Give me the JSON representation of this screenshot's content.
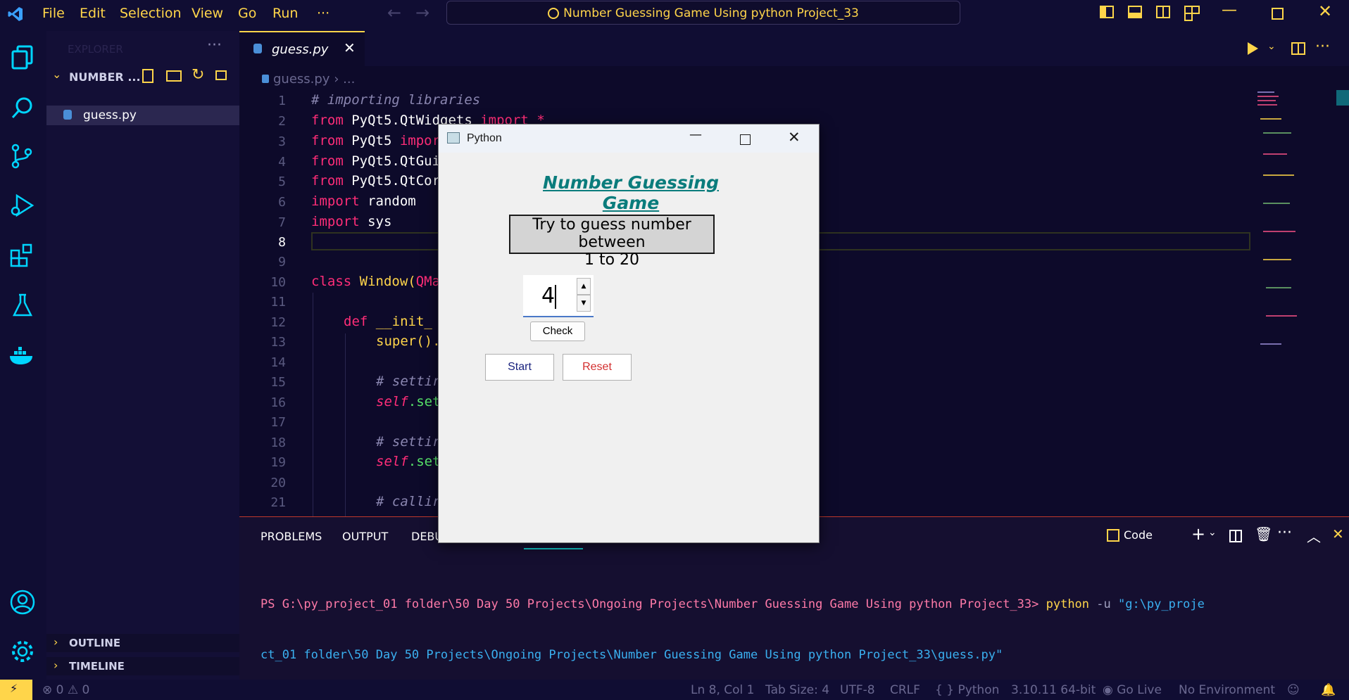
{
  "titlebar": {
    "menu": [
      "File",
      "Edit",
      "Selection",
      "View",
      "Go",
      "Run",
      "···"
    ],
    "search": "Number Guessing Game Using python Project_33"
  },
  "sidebar": {
    "header": "EXPLORER",
    "folder": "NUMBER ...",
    "file": "guess.py",
    "outline": "OUTLINE",
    "timeline": "TIMELINE"
  },
  "editor": {
    "tab": "guess.py",
    "breadcrumb_file": "guess.py",
    "breadcrumb_rest": "...",
    "line_numbers": [
      "1",
      "2",
      "3",
      "4",
      "5",
      "6",
      "7",
      "8",
      "9",
      "10",
      "11",
      "12",
      "13",
      "14",
      "15",
      "16",
      "17",
      "18",
      "19",
      "20",
      "21"
    ],
    "lines": {
      "l1_comment": "# importing libraries",
      "l2_from": "from",
      "l2_mod": " PyQt5.QtWidgets",
      "l2_import": " import",
      "l2_star": " *",
      "l3_from": "from",
      "l3_mod": " PyQt5",
      "l3_import": " impor",
      "l4_from": "from",
      "l4_mod": " PyQt5.QtGui",
      "l5_from": "from",
      "l5_mod": " PyQt5.QtCor",
      "l6_import": "import",
      "l6_mod": " random",
      "l7_import": "import",
      "l7_mod": " sys",
      "l10_class": "class",
      "l10_name": " Window(",
      "l10_base": "QMa",
      "l12_def": "def",
      "l12_name": " __init_",
      "l13_text": "super().",
      "l15_comment": "# settir",
      "l16_self": "self",
      "l16_rest": ".set",
      "l18_comment": "# settir",
      "l19_self": "self",
      "l19_rest": ".set",
      "l21_comment": "# callir"
    }
  },
  "panel": {
    "tabs": [
      "PROBLEMS",
      "OUTPUT",
      "DEBU"
    ],
    "terminal_label": "Code",
    "terminal_line1_prompt": "PS G:\\py_project_01 folder\\50 Day 50 Projects\\Ongoing Projects\\Number Guessing Game Using python Project_33>",
    "terminal_cmd": " python",
    "terminal_flag": " -u",
    "terminal_path1": " \"g:\\py_proje",
    "terminal_line2": "ct_01 folder\\50 Day 50 Projects\\Ongoing Projects\\Number Guessing Game Using python Project_33\\guess.py\""
  },
  "statusbar": {
    "problems": "0",
    "warnings": "0",
    "position": "Ln 8, Col 1",
    "tabsize": "Tab Size: 4",
    "encoding": "UTF-8",
    "eol": "CRLF",
    "language": "Python",
    "version": "3.10.11 64-bit",
    "golive": "Go Live",
    "env": "No Environment"
  },
  "dialog": {
    "title": "Python",
    "heading": "Number Guessing Game",
    "info_line1": "Try to guess number between",
    "info_line2": "1 to 20",
    "spin_value": "4",
    "check": "Check",
    "start": "Start",
    "reset": "Reset"
  },
  "colors": {
    "accent": "#ffd54a",
    "keyword": "#ff2d78",
    "heading": "#0a7c7c",
    "start_text": "#1a237e",
    "reset_text": "#d32f2f"
  }
}
